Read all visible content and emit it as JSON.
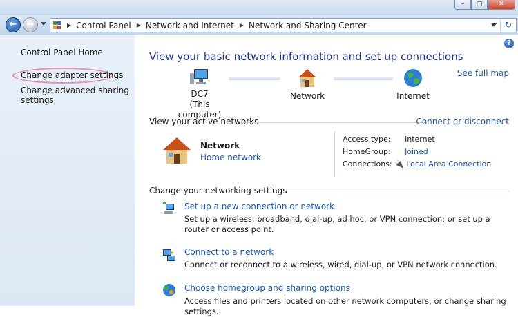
{
  "window": {
    "controls": [
      "–",
      "▢",
      "✕"
    ]
  },
  "breadcrumb": [
    "Control Panel",
    "Network and Internet",
    "Network and Sharing Center"
  ],
  "left_pane": {
    "items": [
      "Control Panel Home",
      "Change adapter settings",
      "Change advanced sharing",
      "settings"
    ]
  },
  "main": {
    "heading": "View your basic network information and set up connections",
    "see_full_map": "See full map",
    "nodes": {
      "computer_name": "DC7",
      "computer_sub": "(This computer)",
      "network": "Network",
      "internet": "Internet"
    },
    "active_networks_label": "View your active networks",
    "connect_or_disconnect": "Connect or disconnect",
    "network_name": "Network",
    "network_type": "Home network",
    "access_type_label": "Access type:",
    "access_type_value": "Internet",
    "homegroup_label": "HomeGroup:",
    "homegroup_value": "Joined",
    "connections_label": "Connections:",
    "connections_value": "Local Area Connection",
    "change_settings_label": "Change your networking settings",
    "tasks": [
      {
        "title": "Set up a new connection or network",
        "desc": "Set up a wireless, broadband, dial-up, ad hoc, or VPN connection; or set up a router or access point."
      },
      {
        "title": "Connect to a network",
        "desc": "Connect or reconnect to a wireless, wired, dial-up, or VPN network connection."
      },
      {
        "title": "Choose homegroup and sharing options",
        "desc": "Access files and printers located on other network computers, or change sharing settings."
      }
    ]
  },
  "colors": {
    "link": "#1e5aa8",
    "heading": "#1e3287",
    "highlight": "#e86d9a"
  }
}
